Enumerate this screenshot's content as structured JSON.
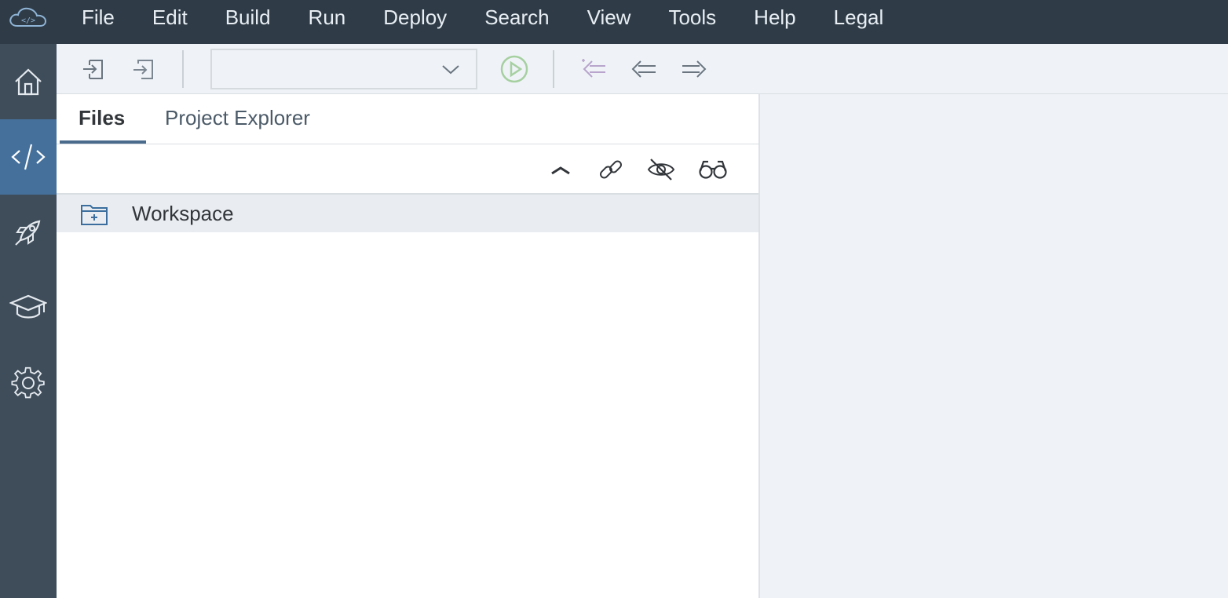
{
  "menu": {
    "items": [
      "File",
      "Edit",
      "Build",
      "Run",
      "Deploy",
      "Search",
      "View",
      "Tools",
      "Help",
      "Legal"
    ]
  },
  "sidenav": {
    "items": [
      {
        "icon": "home-icon",
        "active": false
      },
      {
        "icon": "code-icon",
        "active": true
      },
      {
        "icon": "rocket-icon",
        "active": false
      },
      {
        "icon": "learning-icon",
        "active": false
      },
      {
        "icon": "settings-icon",
        "active": false
      }
    ]
  },
  "toolbar": {
    "run_config_value": "",
    "colors": {
      "run": "#a6d0a0",
      "icons": "#6a7580",
      "disabled_back": "#b8a4cc"
    }
  },
  "panel": {
    "tabs": [
      {
        "label": "Files",
        "active": true
      },
      {
        "label": "Project Explorer",
        "active": false
      }
    ],
    "tree": [
      {
        "label": "Workspace",
        "icon": "folder-icon"
      }
    ]
  },
  "colors": {
    "menubar": "#2f3c48",
    "sidenav": "#3f4d5b",
    "sidenav_active": "#45709b",
    "background": "#eff3f8"
  }
}
